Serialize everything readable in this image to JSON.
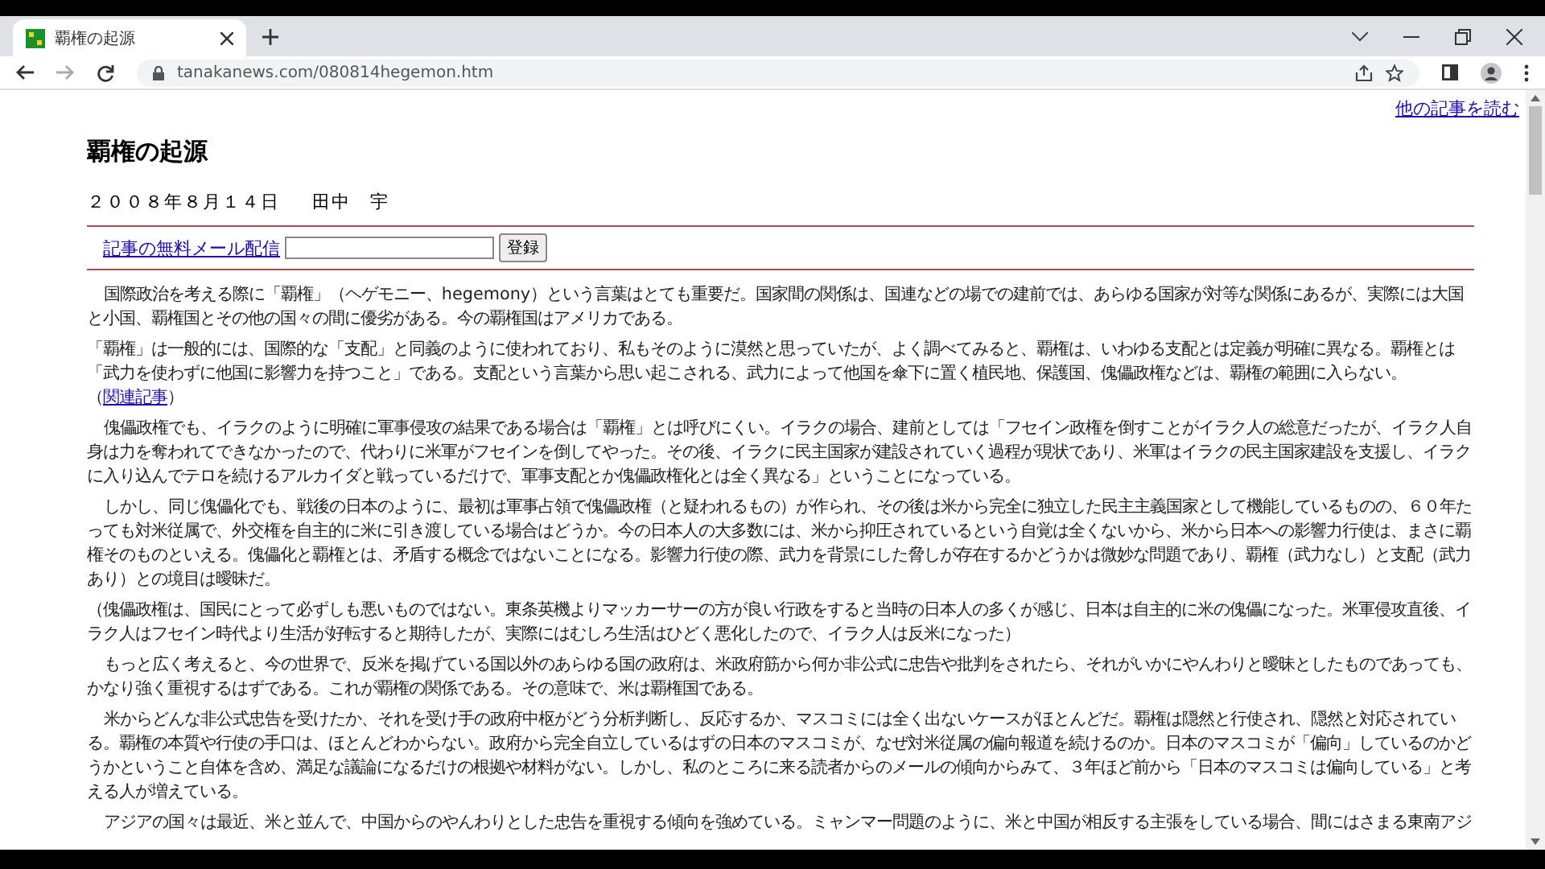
{
  "browser": {
    "tab": {
      "title": "覇権の起源"
    },
    "url": "tanakanews.com/080814hegemon.htm"
  },
  "page": {
    "top_link": "他の記事を読む",
    "title": "覇権の起源",
    "date": "２００８年８月１４日",
    "author": "田中　宇",
    "subscribe": {
      "link": "記事の無料メール配信",
      "button": "登録"
    },
    "paragraphs": [
      {
        "indent": true,
        "parts": [
          {
            "kind": "text",
            "text": "国際政治を考える際に「覇権」（ヘゲモニー、hegemony）という言葉はとても重要だ。国家間の関係は、国連などの場での建前では、あらゆる国家が対等な関係にあるが、実際には大国と小国、覇権国とその他の国々の間に優劣がある。今の覇権国はアメリカである。"
          }
        ]
      },
      {
        "indent": false,
        "parts": [
          {
            "kind": "text",
            "text": "「覇権」は一般的には、国際的な「支配」と同義のように使われており、私もそのように漠然と思っていたが、よく調べてみると、覇権は、いわゆる支配とは定義が明確に異なる。覇権とは「武力を使わずに他国に影響力を持つこと」である。支配という言葉から思い起こされる、武力によって他国を傘下に置く植民地、保護国、傀儡政権などは、覇権の範囲に入らない。（"
          },
          {
            "kind": "link",
            "text": "関連記事"
          },
          {
            "kind": "text",
            "text": "）"
          }
        ]
      },
      {
        "indent": true,
        "parts": [
          {
            "kind": "text",
            "text": "傀儡政権でも、イラクのように明確に軍事侵攻の結果である場合は「覇権」とは呼びにくい。イラクの場合、建前としては「フセイン政権を倒すことがイラク人の総意だったが、イラク人自身は力を奪われてできなかったので、代わりに米軍がフセインを倒してやった。その後、イラクに民主国家が建設されていく過程が現状であり、米軍はイラクの民主国家建設を支援し、イラクに入り込んでテロを続けるアルカイダと戦っているだけで、軍事支配とか傀儡政権化とは全く異なる」ということになっている。"
          }
        ]
      },
      {
        "indent": true,
        "parts": [
          {
            "kind": "text",
            "text": "しかし、同じ傀儡化でも、戦後の日本のように、最初は軍事占領で傀儡政権（と疑われるもの）が作られ、その後は米から完全に独立した民主主義国家として機能しているものの、６０年たっても対米従属で、外交権を自主的に米に引き渡している場合はどうか。今の日本人の大多数には、米から抑圧されているという自覚は全くないから、米から日本への影響力行使は、まさに覇権そのものといえる。傀儡化と覇権とは、矛盾する概念ではないことになる。影響力行使の際、武力を背景にした脅しが存在するかどうかは微妙な問題であり、覇権（武力なし）と支配（武力あり）との境目は曖昧だ。"
          }
        ]
      },
      {
        "indent": false,
        "parts": [
          {
            "kind": "text",
            "text": "（傀儡政権は、国民にとって必ずしも悪いものではない。東条英機よりマッカーサーの方が良い行政をすると当時の日本人の多くが感じ、日本は自主的に米の傀儡になった。米軍侵攻直後、イラク人はフセイン時代より生活が好転すると期待したが、実際にはむしろ生活はひどく悪化したので、イラク人は反米になった）"
          }
        ]
      },
      {
        "indent": true,
        "parts": [
          {
            "kind": "text",
            "text": "もっと広く考えると、今の世界で、反米を掲げている国以外のあらゆる国の政府は、米政府筋から何か非公式に忠告や批判をされたら、それがいかにやんわりと曖昧としたものであっても、かなり強く重視するはずである。これが覇権の関係である。その意味で、米は覇権国である。"
          }
        ]
      },
      {
        "indent": true,
        "parts": [
          {
            "kind": "text",
            "text": "米からどんな非公式忠告を受けたか、それを受け手の政府中枢がどう分析判断し、反応するか、マスコミには全く出ないケースがほとんどだ。覇権は隠然と行使され、隠然と対応されている。覇権の本質や行使の手口は、ほとんどわからない。政府から完全自立しているはずの日本のマスコミが、なぜ対米従属の偏向報道を続けるのか。日本のマスコミが「偏向」しているのかどうかということ自体を含め、満足な議論になるだけの根拠や材料がない。しかし、私のところに来る読者からのメールの傾向からみて、３年ほど前から「日本のマスコミは偏向している」と考える人が増えている。"
          }
        ]
      },
      {
        "indent": true,
        "parts": [
          {
            "kind": "text",
            "text": "アジアの国々は最近、米と並んで、中国からのやんわりとした忠告を重視する傾向を強めている。ミャンマー問題のように、米と中国が相反する主張をしている場合、間にはさまる東南アジ"
          }
        ]
      }
    ]
  }
}
